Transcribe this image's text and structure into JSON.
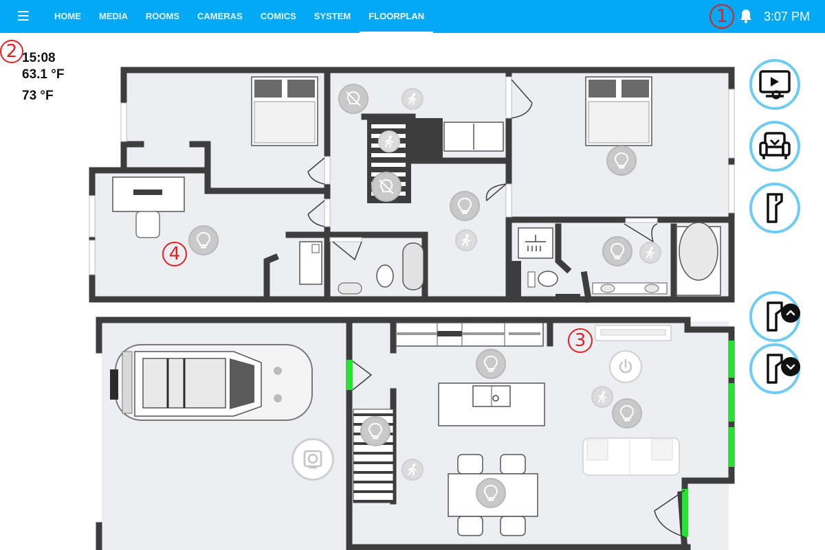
{
  "header": {
    "menu_icon": "hamburger-menu-icon",
    "tabs": [
      {
        "label": "HOME"
      },
      {
        "label": "MEDIA"
      },
      {
        "label": "ROOMS"
      },
      {
        "label": "CAMERAS"
      },
      {
        "label": "COMICS"
      },
      {
        "label": "SYSTEM"
      },
      {
        "label": "FLOORPLAN",
        "active": true
      }
    ],
    "notification_icon": "bell-icon",
    "time": "3:07 PM",
    "bar_color": "#03a9f4"
  },
  "annotations": {
    "a1": "1",
    "a2": "2",
    "a3": "3",
    "a4": "4",
    "color": "#e02020"
  },
  "info": {
    "time": "15:08",
    "temp_1": "63.1 °F",
    "temp_2": "73 °F"
  },
  "side_buttons": [
    {
      "icon": "media-player-icon"
    },
    {
      "icon": "armchair-icon"
    },
    {
      "icon": "garage-door-icon"
    },
    {
      "icon": "garage-door-open-icon"
    },
    {
      "icon": "garage-door-close-icon"
    }
  ],
  "colors": {
    "light_on": "#f4c95a",
    "light_off": "#c9c9c9",
    "door_open": "#22e62d",
    "button_ring": "#6ecbf4",
    "wall": "#3d3d3d",
    "floor": "#eceef2"
  }
}
